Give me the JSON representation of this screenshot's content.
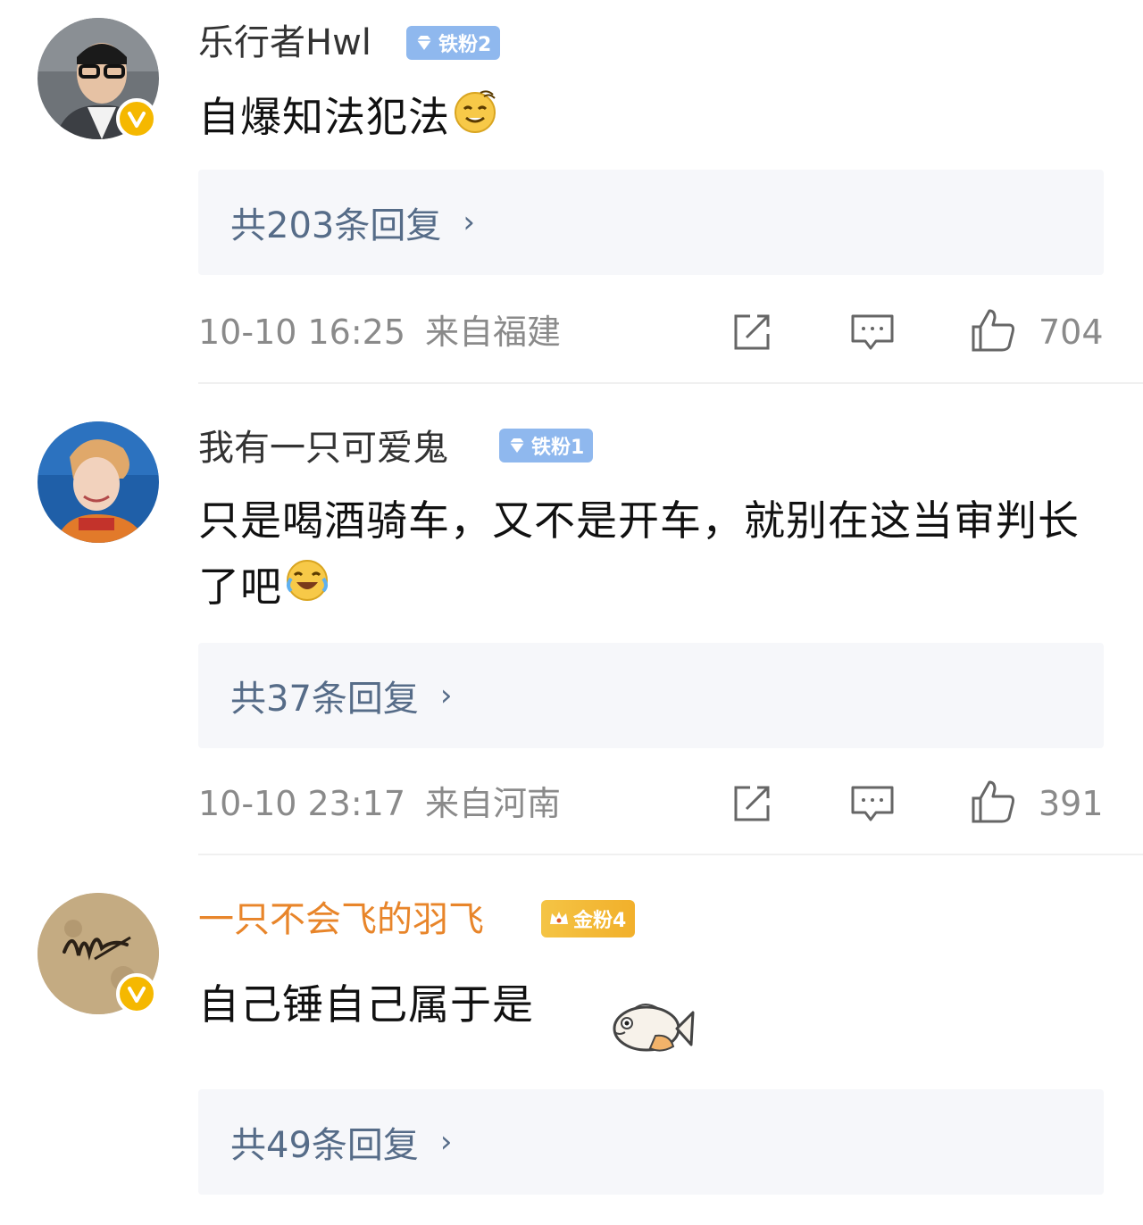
{
  "comments": [
    {
      "username": "乐行者Hwl",
      "fan_badge": "铁粉2",
      "text": "自爆知法犯法",
      "replies": "共203条回复",
      "time": "10-10 16:25",
      "location": "来自福建",
      "likes": "704"
    },
    {
      "username": "我有一只可爱鬼",
      "fan_badge": "铁粉1",
      "text": "只是喝酒骑车，又不是开车，就别在这当审判长了吧",
      "replies": "共37条回复",
      "time": "10-10 23:17",
      "location": "来自河南",
      "likes": "391"
    },
    {
      "username": "一只不会飞的羽飞",
      "fan_badge": "金粉4",
      "text": "自己锤自己属于是",
      "replies": "共49条回复"
    }
  ],
  "colors": {
    "username": "#333333",
    "username_gold": "#e8852a",
    "reply_link": "#566c88",
    "reply_bg": "#f6f7fa",
    "meta": "#8a8a8a",
    "iron_badge": "#8fb8ee",
    "gold_badge": "#f2b02b",
    "verified": "#f5b800"
  },
  "icons": [
    "verified-v-icon",
    "diamond-gem-icon",
    "crown-icon",
    "share-icon",
    "comment-icon",
    "like-thumb-icon",
    "chevron-right-icon",
    "emoji-smug-icon",
    "emoji-laugh-cry-icon",
    "emoji-fish-icon"
  ]
}
